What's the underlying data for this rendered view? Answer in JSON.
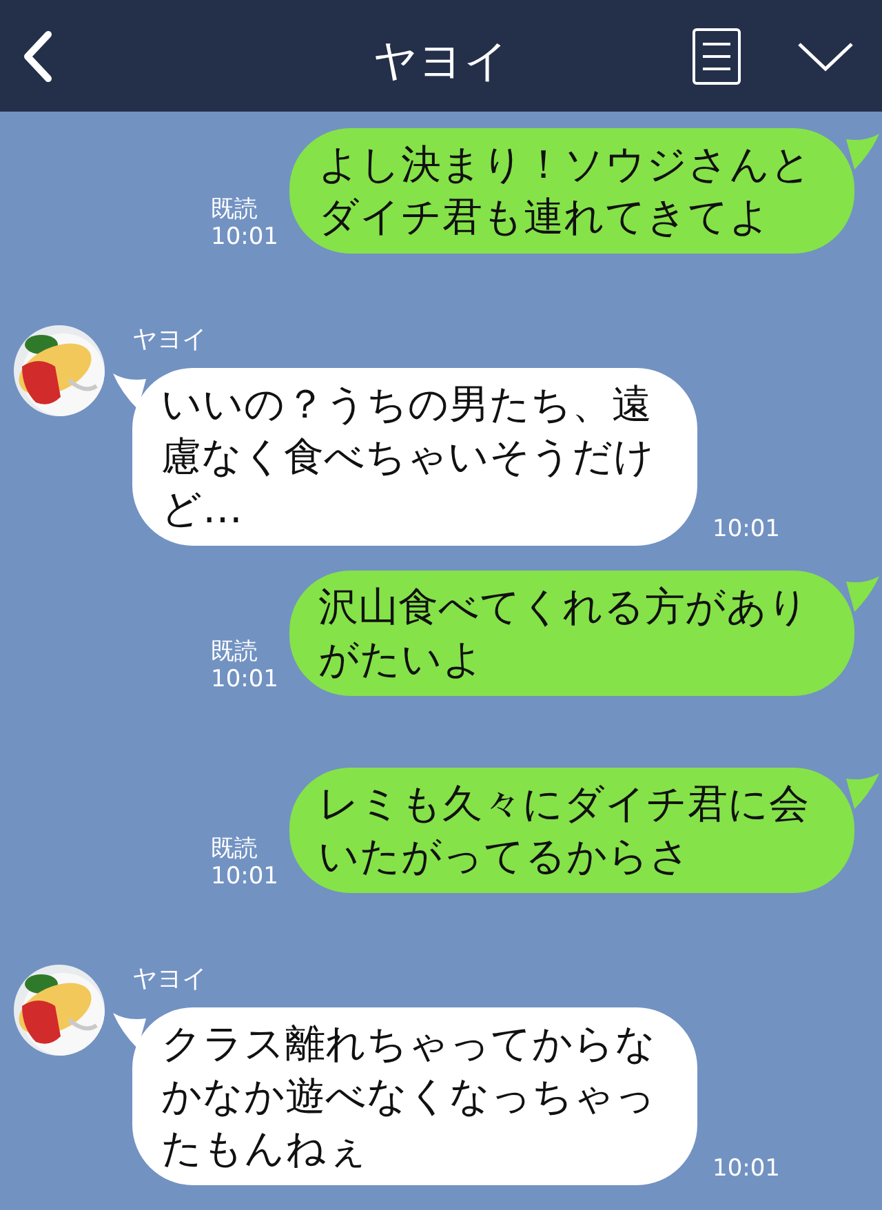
{
  "header": {
    "title": "ヤヨイ"
  },
  "messages": [
    {
      "kind": "sent",
      "text": "よし決まり！ソウジさんとダイチ君も連れてきてよ",
      "read": "既読",
      "time": "10:01"
    },
    {
      "kind": "received",
      "sender": "ヤヨイ",
      "text": "いいの？うちの男たち、遠慮なく食べちゃいそうだけど…",
      "time": "10:01"
    },
    {
      "kind": "sent",
      "text": "沢山食べてくれる方がありがたいよ",
      "read": "既読",
      "time": "10:01"
    },
    {
      "kind": "sent",
      "text": "レミも久々にダイチ君に会いたがってるからさ",
      "read": "既読",
      "time": "10:01"
    },
    {
      "kind": "received",
      "sender": "ヤヨイ",
      "text": "クラス離れちゃってからなかなか遊べなくなっちゃったもんねぇ",
      "time": "10:01"
    }
  ]
}
